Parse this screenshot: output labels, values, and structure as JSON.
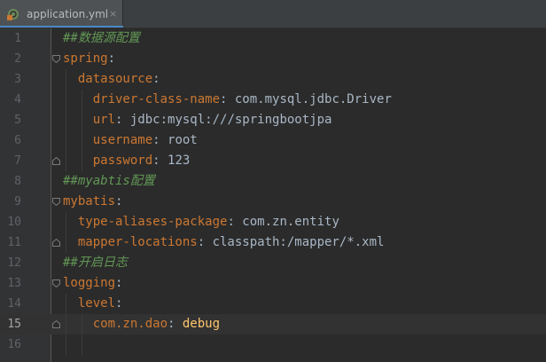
{
  "tab": {
    "file_name": "application.yml",
    "close_glyph": "×",
    "icon": "yaml-file-icon"
  },
  "editor": {
    "current_line": 15,
    "lines": [
      {
        "num": "1",
        "parts": [
          {
            "t": "##数据源配置",
            "c": "comment"
          }
        ]
      },
      {
        "num": "2",
        "parts": [
          {
            "t": "spring",
            "c": "key"
          },
          {
            "t": ":",
            "c": "val"
          }
        ]
      },
      {
        "num": "3",
        "parts": [
          {
            "t": "  "
          },
          {
            "t": "datasource",
            "c": "key"
          },
          {
            "t": ":",
            "c": "val"
          }
        ]
      },
      {
        "num": "4",
        "parts": [
          {
            "t": "    "
          },
          {
            "t": "driver-class-name",
            "c": "key"
          },
          {
            "t": ": com.mysql.jdbc.Driver",
            "c": "val"
          }
        ]
      },
      {
        "num": "5",
        "parts": [
          {
            "t": "    "
          },
          {
            "t": "url",
            "c": "key"
          },
          {
            "t": ": jdbc:mysql:///springbootjpa",
            "c": "val"
          }
        ]
      },
      {
        "num": "6",
        "parts": [
          {
            "t": "    "
          },
          {
            "t": "username",
            "c": "key"
          },
          {
            "t": ": root",
            "c": "val"
          }
        ]
      },
      {
        "num": "7",
        "parts": [
          {
            "t": "    "
          },
          {
            "t": "password",
            "c": "key"
          },
          {
            "t": ": 123",
            "c": "val"
          }
        ]
      },
      {
        "num": "8",
        "parts": [
          {
            "t": "##myabtis配置",
            "c": "comment"
          }
        ]
      },
      {
        "num": "9",
        "parts": [
          {
            "t": "mybatis",
            "c": "key"
          },
          {
            "t": ":",
            "c": "val"
          }
        ]
      },
      {
        "num": "10",
        "parts": [
          {
            "t": "  "
          },
          {
            "t": "type-aliases-package",
            "c": "key"
          },
          {
            "t": ": com.zn.entity",
            "c": "val"
          }
        ]
      },
      {
        "num": "11",
        "parts": [
          {
            "t": "  "
          },
          {
            "t": "mapper-locations",
            "c": "key"
          },
          {
            "t": ": classpath:/mapper/*.xml",
            "c": "val"
          }
        ]
      },
      {
        "num": "12",
        "parts": [
          {
            "t": "##开启日志",
            "c": "comment"
          }
        ]
      },
      {
        "num": "13",
        "parts": [
          {
            "t": "logging",
            "c": "key"
          },
          {
            "t": ":",
            "c": "val"
          }
        ]
      },
      {
        "num": "14",
        "parts": [
          {
            "t": "  "
          },
          {
            "t": "level",
            "c": "key"
          },
          {
            "t": ":",
            "c": "val"
          }
        ]
      },
      {
        "num": "15",
        "parts": [
          {
            "t": "    "
          },
          {
            "t": "com.zn.dao",
            "c": "key"
          },
          {
            "t": ": ",
            "c": "val"
          },
          {
            "t": "debug",
            "c": "debug"
          }
        ]
      },
      {
        "num": "16",
        "parts": []
      }
    ]
  },
  "colors": {
    "background": "#2b2b2b",
    "key": "#cc7832",
    "value": "#a9b7c6",
    "comment": "#629755",
    "highlight_value": "#ffc66d",
    "tab_underline": "#4a88c7"
  }
}
